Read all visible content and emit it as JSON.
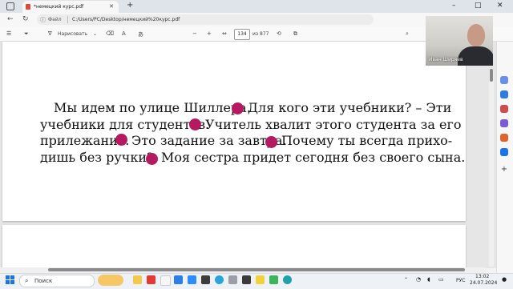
{
  "browser": {
    "tab_title": "*немецкий курс.pdf",
    "new_tab": "+",
    "window_buttons": [
      "–",
      "□",
      "✕"
    ],
    "nav_icons": [
      "back-icon",
      "refresh-icon"
    ],
    "address_label": "Файл",
    "url": "C:/Users/PC/Desktop/немецкий%20курс.pdf"
  },
  "pdf_toolbar": {
    "draw_label": "Нарисовать",
    "zoom_out": "−",
    "zoom_in": "+",
    "page_current": "134",
    "page_total": "из 877"
  },
  "document": {
    "lines": [
      "Мы идем по улице Шиллера.",
      "Для кого эти учебники? – Эти",
      "учебники для студентов.",
      "Учитель хвалит этого студента за его",
      "прилежание.",
      "Это задание за завтра.",
      "Почему ты всегда прихо-",
      "дишь без ручки?",
      "Моя сестра придет сегодня без своего сына."
    ],
    "marker_color": "#b5195f"
  },
  "webcam": {
    "name": "Иван Ширяев"
  },
  "taskbar": {
    "search_placeholder": "Поиск",
    "tray_language": "РУС",
    "time": "13:02",
    "date": "24.07.2024"
  },
  "colors": {
    "accent": "#1a73e8",
    "tab_bar": "#dfe3ea"
  }
}
